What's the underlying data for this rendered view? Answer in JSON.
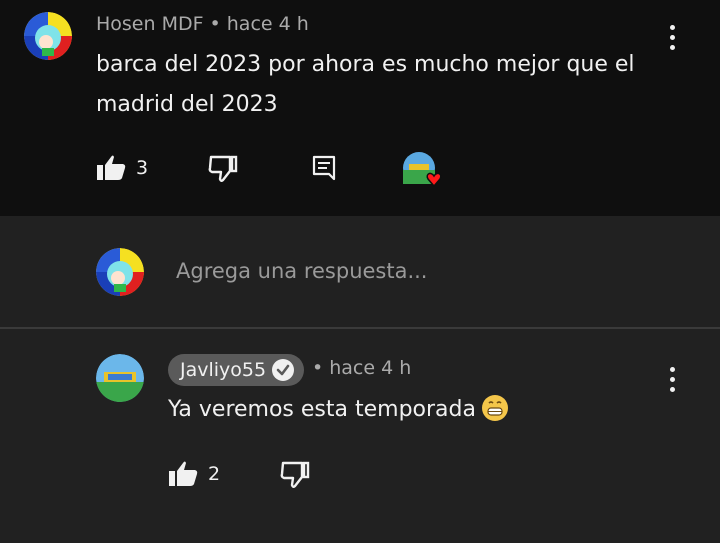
{
  "comment": {
    "author": "Hosen MDF",
    "separator": "•",
    "time": "hace 4 h",
    "text": "barca del 2023 por ahora es mucho mejor que el madrid del 2023",
    "likes": "3"
  },
  "reply_box": {
    "placeholder": "Agrega una respuesta..."
  },
  "reply": {
    "author": "Javliyo55",
    "separator": "•",
    "time": "hace 4 h",
    "text": "Ya veremos esta temporada",
    "likes": "2"
  },
  "icons": {
    "like": "thumb-up-icon",
    "dislike": "thumb-down-icon",
    "reply": "comment-icon",
    "heart": "heart-icon",
    "more": "more-vert-icon",
    "verified": "check-circle-icon"
  },
  "colors": {
    "background_top": "#0f0f0f",
    "background": "#212121",
    "heart": "#ff1a1a",
    "chip": "#5a5a5a"
  }
}
